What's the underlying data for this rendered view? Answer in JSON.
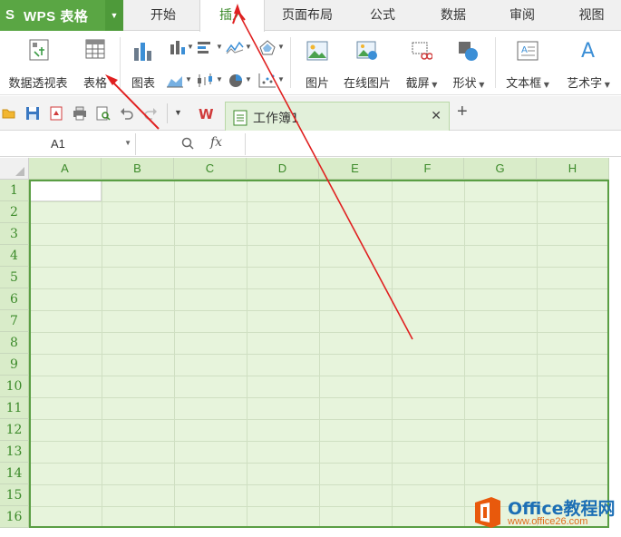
{
  "app": {
    "logo_char": "S",
    "title": "WPS 表格"
  },
  "menu": {
    "tabs": [
      {
        "label": "开始"
      },
      {
        "label": "插入",
        "active": true
      },
      {
        "label": "页面布局"
      },
      {
        "label": "公式"
      },
      {
        "label": "数据"
      },
      {
        "label": "审阅"
      },
      {
        "label": "视图"
      }
    ]
  },
  "ribbon": {
    "pivot_table": "数据透视表",
    "table": "表格",
    "chart": "图表",
    "picture": "图片",
    "online_picture": "在线图片",
    "screenshot": "截屏",
    "shapes": "形状",
    "textbox": "文本框",
    "wordart": "艺术字"
  },
  "doc_tabs": [
    {
      "name": "工作簿1"
    }
  ],
  "formula_bar": {
    "cell_ref": "A1",
    "fx_label": "fx",
    "value": ""
  },
  "grid": {
    "columns": [
      "A",
      "B",
      "C",
      "D",
      "E",
      "F",
      "G",
      "H"
    ],
    "rows": [
      "1",
      "2",
      "3",
      "4",
      "5",
      "6",
      "7",
      "8",
      "9",
      "10",
      "11",
      "12",
      "13",
      "14",
      "15",
      "16"
    ]
  },
  "watermark": {
    "brand": "Office教程网",
    "url": "www.office26.com"
  },
  "colors": {
    "accent_green": "#5aa644",
    "selection_fill": "#e7f4dc",
    "annotation_red": "#e02020"
  }
}
